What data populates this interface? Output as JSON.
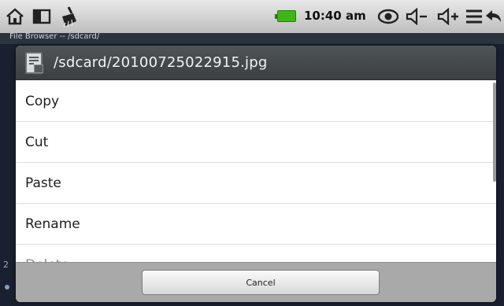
{
  "status_bar": {
    "time": "10:40 am",
    "icons": [
      "home-icon",
      "window-icon",
      "broom-icon",
      "battery-icon",
      "eye-icon",
      "volume-down-icon",
      "volume-up-icon",
      "menu-icon",
      "back-icon"
    ],
    "volume_down_label": "◁−",
    "volume_up_label": "◁+"
  },
  "background_app": {
    "title": "File Browser -- /sdcard/",
    "bottom_text": "2"
  },
  "dialog": {
    "title": "/sdcard/20100725022915.jpg",
    "items": [
      {
        "label": "Copy"
      },
      {
        "label": "Cut"
      },
      {
        "label": "Paste"
      },
      {
        "label": "Rename"
      },
      {
        "label": "Delete"
      }
    ],
    "cancel_label": "Cancel"
  },
  "colors": {
    "status_bar": "#d0d0d0",
    "battery": "#3fb618",
    "dialog_header": "#45494c",
    "dialog_footer": "#a9a9a9"
  }
}
